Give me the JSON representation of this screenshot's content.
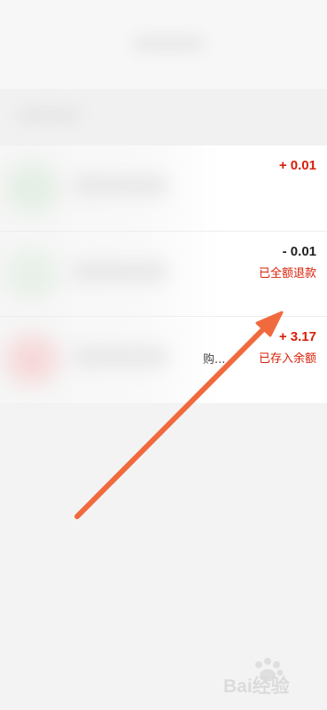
{
  "transactions": [
    {
      "amount": "+ 0.01",
      "status": "",
      "truncated_text": ""
    },
    {
      "amount": "- 0.01",
      "status": "已全额退款",
      "truncated_text": ""
    },
    {
      "amount": "+ 3.17",
      "status": "已存入余额",
      "truncated_text": "购..."
    }
  ],
  "colors": {
    "accent_red": "#d81e06",
    "arrow": "#f06a3e",
    "background": "#f3f3f3"
  },
  "watermark": {
    "text": "Bai经验",
    "icon": "baidu-paw-icon"
  }
}
